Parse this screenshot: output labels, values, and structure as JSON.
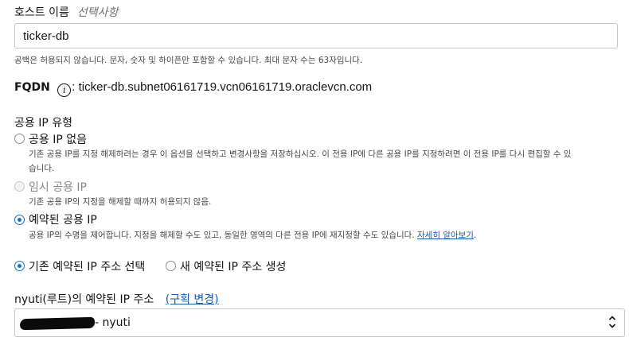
{
  "host": {
    "label": "호스트 이름",
    "optional": "선택사항",
    "value": "ticker-db",
    "help": "공백은 허용되지 않습니다. 문자, 숫자 및 하이픈만 포함할 수 있습니다. 최대 문자 수는 63자입니다."
  },
  "fqdn": {
    "label": "FQDN",
    "info_glyph": "i",
    "value": ": ticker-db.subnet06161719.vcn06161719.oraclevcn.com"
  },
  "public_ip": {
    "label": "공용 IP 유형",
    "options": [
      {
        "label": "공용 IP 없음",
        "desc_line1": "기존 공용 IP를 지정 해제하려는 경우 이 옵션을 선택하고 변경사항을 저장하십시오. 이 전용 IP에 다른 공용 IP를 지정하려면 이 전용 IP를 다시 편집할 수 있",
        "desc_line2": "습니다.",
        "checked": false,
        "disabled": false
      },
      {
        "label": "임시 공용 IP",
        "desc_line1": "기존 공용 IP의 지정을 해제할 때까지 허용되지 않음.",
        "checked": false,
        "disabled": true
      },
      {
        "label": "예약된 공용 IP",
        "desc_line1": "공용 IP의 수명을 제어합니다. 지정을 해제할 수도 있고, 동일한 영역의 다른 전용 IP에 재지정할 수도 있습니다. ",
        "learn_more": "자세히 알아보기",
        "desc_suffix": ".",
        "checked": true,
        "disabled": false
      }
    ]
  },
  "reserved_choice": {
    "existing_label": "기존 예약된 IP 주소 선택",
    "new_label": "새 예약된 IP 주소 생성",
    "existing_checked": true
  },
  "compartment": {
    "label": "nyuti(루트)의 예약된 IP 주소",
    "change_link": "(구획 변경)"
  },
  "reserved_ip_select": {
    "selected_suffix": "- nyuti"
  },
  "colors": {
    "accent": "#1f6fbf",
    "link": "#1a5aa8",
    "text": "#161513",
    "muted": "#4a4846"
  }
}
